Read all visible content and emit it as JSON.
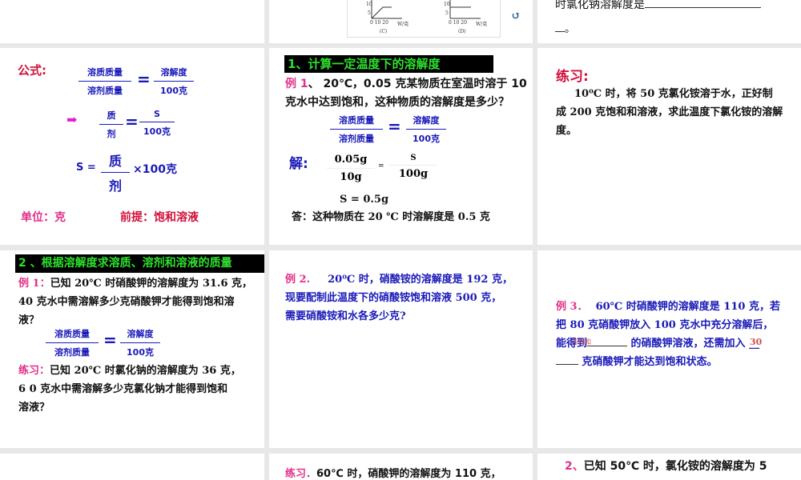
{
  "slides": {
    "s0b": {
      "ticks_c": "0 10 20",
      "ticks_d": "0 10 20",
      "axis": "W/克",
      "y10": "10",
      "y5": "5",
      "label_c": "(C)",
      "label_d": "(D)"
    },
    "s0c": {
      "line1": "时氯化钠溶解度是",
      "line2": "。"
    },
    "s1a": {
      "label": "公式:",
      "num1": "溶质质量",
      "den1": "溶剂质量",
      "num2": "溶解度",
      "den2": "100克",
      "num3": "质",
      "den3": "剂",
      "num4": "S",
      "den4": "100克",
      "s_eq": "S  =",
      "num5": "质",
      "den5": "剂",
      "times": "×100克",
      "unit": "单位：克",
      "premise": "前提：饱和溶液",
      "eq": "="
    },
    "s1b": {
      "header": "1、计算一定温度下的溶解度",
      "ex_label": "例 1",
      "ex_text1": "、 20℃，0.05 克某物质在室温时溶于 10",
      "ex_text2": "克水中达到饱和，这种物质的溶解度是多少？",
      "num1": "溶质质量",
      "den1": "溶剂质量",
      "num2": "溶解度",
      "den2": "100克",
      "jie": "解:",
      "n_a": "0.05g",
      "d_a": "10g",
      "n_b": "S",
      "d_b": "100g",
      "small_eq": "=",
      "result": "S = 0.5g",
      "answer": "答：这种物质在 20 ℃ 时溶解度是 0.5 克",
      "eq": "="
    },
    "s1c": {
      "title": "练习:",
      "line1": "10⁰C 时，将 50 克氯化铵溶于水，正好制",
      "line2": "成 200 克饱和和溶液，求此温度下氯化铵的溶解",
      "line3": "度。"
    },
    "s2a": {
      "header": "2 、根据溶解度求溶质、溶剂和溶液的质量",
      "ex_label": "例 1：",
      "l1": "已知 20℃ 时硝酸钾的溶解度为 31.6 克，",
      "l2": "40 克水中需溶解多少克硝酸钾才能得到饱和溶",
      "l3": "液？",
      "num1": "溶质质量",
      "den1": "溶剂质量",
      "num2": "溶解度",
      "den2": "100克",
      "eq": "=",
      "pr_label": "练习：",
      "p1": "已知 20℃ 时氯化钠的溶解度为 36 克，",
      "p2": " 6  0 克水中需溶解多少克氯化钠才能得到饱和",
      "p3": "溶液？"
    },
    "s2b": {
      "ex_label": "例 2.",
      "l1": "20⁰C 时，硝酸铵的溶解度是 192 克，",
      "l2": "现要配制此温度下的硝酸铵饱和溶液 500 克，",
      "l3": "需要硝酸铵和水各多少克?"
    },
    "s2c": {
      "ex_label": "例 3．",
      "l1": "60℃ 时硝酸钾的溶解度是 110 克，若",
      "l2": "把 80 克硝酸钾放入 100 克水中充分溶解后，",
      "l3a": "能得到",
      "l3b": "的硝酸钾溶液，还需加入 __",
      "l4": "克硝酸钾才能达到饱和状态。",
      "ans1": "不饱和",
      "ans2": "30"
    },
    "s3b": {
      "label": "练习．",
      "text": "60℃ 时，硝酸钾的溶解度为 110 克，"
    },
    "s3c": {
      "label": "2、",
      "text": "已知 50℃ 时，氯化铵的溶解度为 5"
    }
  }
}
